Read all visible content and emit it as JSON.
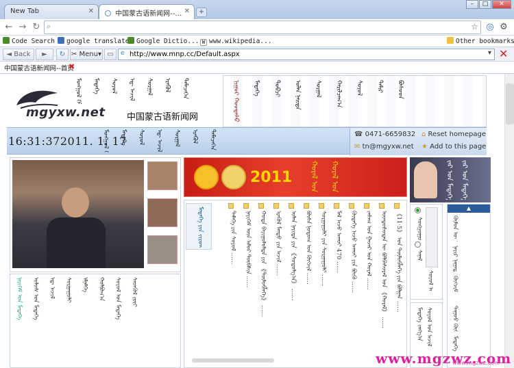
{
  "tabs": [
    {
      "label": "New Tab",
      "active": false
    },
    {
      "label": "中国蒙古语新闻网--…",
      "active": true
    }
  ],
  "window": {
    "min": "–",
    "max": "□",
    "close": "✕"
  },
  "omnibox": {
    "value": "",
    "placeholder": ""
  },
  "bookmarks": [
    {
      "label": "Code Search",
      "color": "#4a8a2a"
    },
    {
      "label": "google translate",
      "color": "#3b6fb6"
    },
    {
      "label": "Google Dictio...",
      "color": "#4a8a2a"
    },
    {
      "label": "www.wikipedia...",
      "color": "#333333"
    }
  ],
  "other_bookmarks": "Other bookmarks",
  "ie_toolbar": {
    "back": "Back",
    "menu": "Menu",
    "address": "http://www.mnp.cc/Default.aspx"
  },
  "ie_tab": {
    "label": "中国蒙古语新闻网--首页"
  },
  "site": {
    "logo_text": "mgyxw.net",
    "site_name": "中国蒙古语新闻网",
    "clock": "16:31:372011. 1. 17",
    "phone": "0471-6659832",
    "email": "tn@mgyxw.net",
    "reset_homepage": "Reset homepage",
    "add_page": "Add to this page",
    "banner_year": "2011"
  },
  "mongolian": {
    "header_cols": [
      "ᠮᠣᠩᠭᠣᠯ ᠬᠡᠯᠡ",
      "ᠮᠡᠳᠡᠭᠡ",
      "ᠰᠣᠶᠣᠯ",
      "ᠡᠳ᠋ ᠠᠵᠢᠯ",
      "ᠰᠤᠷᠭᠠᠯ",
      "ᠡᠷᠡᠭᠦᠯ",
      "ᠲᠡᠮᠡᠴᠡᠭᠡᠨ"
    ],
    "menu_cols": [
      "ᠨᠢᠭᠤᠷ ᠬᠤᠤᠳᠠᠰᠤ",
      "ᠮᠡᠳᠡᠭᠡ",
      "ᠲᠣᠪᠴᠢ",
      "ᠣᠯᠠᠨ ᠨᠡᠢᠲᠡ",
      "ᠰᠤᠷᠭᠠᠯ",
      "ᠬᠠᠷᠢᠯᠴᠠᠭ᠎ᠠ",
      "ᠰᠣᠶᠣᠯ",
      "ᠲᠠᠮᠢᠷ",
      "ᠪᠤᠰᠤᠳ"
    ],
    "left_list": [
      "ᠨᠡᠶᠢᠭᠡᠮ ᠤᠨ ᠮᠡᠳᠡᠭᠡ",
      "ᠤᠯᠤᠰ ᠤᠨ ᠮᠡᠳᠡᠭᠡ",
      "ᠡᠳ᠋ ᠠᠵᠢᠯ",
      "ᠰᠤᠷᠭᠠᠭᠤᠯᠢ",
      "ᠡᠮᠨᠡᠯᠭᠡ",
      "ᠬᠣᠯᠪᠣᠭ᠎ᠠ",
      "ᠰᠣᠶᠣᠯ ᠤᠨ ᠮᠡᠳᠡᠭᠡ",
      "ᠰᠡᠳᠭᠦᠯ ᠵᠦᠢ"
    ],
    "news_list": [
      "《11·5》 ᠤᠨ ᠲᠥᠯᠥᠪᠯᠡᠭᠡ ᠶᠢᠨ ᠪᠤᠯᠭᠠᠨ ……",
      "ᠦᠨᠳᠦᠰᠦᠲᠡᠨ ᠦ ᠪᠣᠯᠪᠠᠰᠤᠷᠠᠯ ᠤᠨ 《ᠬᠤᠷᠠᠯ》 ……",
      "ᠵᠠᠰᠠᠭ ᠤᠨ ᠭᠠᠵᠠᠷ ᠤᠨ ᠬᠤᠷᠠᠯ ……",
      "ᠬᠥᠳᠡᠭᠡ ᠠᠵᠤ ᠠᠬᠤᠢ ᠶᠢᠨ ᠪᠥᠬᠥ ……",
      "ᠮᠠᠯ ᠠᠵᠤ ᠠᠬᠤᠢ 470 ……",
      "ᠰᠤᠷᠭᠠᠭᠤᠯᠢ ᠶᠢᠨ ᠰᠤᠷᠭᠠᠭᠤᠯᠢ ……",
      "ᠪᠦᠰᠡ ᠨᠤᠲᠤᠭ ᠤᠨ ᠬᠥᠭᠵᠢᠯ ……",
      "ᠣᠯᠠᠨ ᠨᠡᠶᠢᠲᠡ ᠶᠢᠨ 《ᠰᠤᠳᠤᠯᠭ᠎ᠠ》 ……",
      "ᠡᠷᠡᠭᠦᠯ ᠮᠡᠨᠳᠦ ᠶᠢᠨ ᠠᠵᠢᠯ ……",
      "ᠬᠤᠲᠠ ᠪᠠᠶᠢᠭᠤᠯᠤᠯᠲᠠ ᠶᠢᠨ 《ᠲᠥᠯᠥᠪᠯᠡᠭᠡ》 ……",
      "ᠨᠡᠶᠢᠭᠡᠮ ᠦᠨ ᠠᠮᠤᠷ ᠲᠦᠪᠰᠢᠨ ……",
      "ᠲᠡᠮᠡᠭᠡ ᠶᠢᠨ ᠰᠣᠶᠣᠯ ……",
      "《11·5》 ᠤᠨ ᠪᠣᠳᠣᠯᠭ᠎ᠠ ……"
    ],
    "side_list": [
      "ᠰᠣᠩᠭᠣᠭᠤᠯᠢ",
      "ᠰᠠᠨᠠᠯ",
      "ᠰᠣᠶᠣᠯ ᠤᠨ ᠠᠵᠢᠯ",
      "ᠮᠡᠳᠡᠭᠡ ᠵᠠᠩᠭ᠎ᠠ"
    ],
    "right_list": [
      "ᠬᠦᠮᠦᠨ ᠦ ᠠᠮᠢᠳᠤᠷᠠᠯ",
      "ᠨᠠᠶᠢᠷ ᠨᠠᠭᠠᠳᠤᠮ",
      "ᠬᠥᠭᠵᠢᠮ",
      "ᠳᠠᠭᠤᠤ ᠬᠥᠭᠵᠢᠮ",
      "ᠮᠡᠳᠡᠭᠡ"
    ],
    "banner_script": "ᠬᠤᠷᠠᠯ ᠤᠨ ᠮᠡᠳᠡᠭᠡ",
    "model_script": "ᠵᠠᠷ ᠤᠨ ᠮᠡᠳᠡᠭᠡ",
    "photo_caption": "ᠮᠡᠳᠡᠭᠡ ᠶᠢᠨ ᠵᠢᠷᠤᠭ"
  },
  "watermark": "www.mgzwz.com",
  "watermark_sub": "www.mgzwz.com",
  "colors": {
    "banner": "#d22a1c",
    "watermark": "#e020a0",
    "bar": "#c4d8ee"
  }
}
